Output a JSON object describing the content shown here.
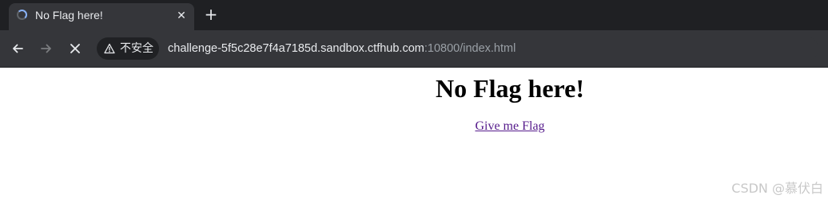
{
  "browser": {
    "tab": {
      "title": "No Flag here!",
      "loading": true
    },
    "toolbar": {
      "security_label": "不安全",
      "url_host": "challenge-5f5c28e7f4a7185d.sandbox.ctfhub.com",
      "url_rest": ":10800/index.html"
    },
    "icons": {
      "back": "arrow-left-icon",
      "forward": "arrow-right-icon",
      "stop": "close-icon",
      "new_tab": "plus-icon",
      "tab_close": "close-icon",
      "security": "warning-triangle-icon"
    },
    "colors": {
      "chrome_dark": "#1f2023",
      "toolbar": "#35363a",
      "text_light": "#e8eaed",
      "text_dim": "#9aa0a6",
      "visited_link": "#551a8b"
    }
  },
  "page": {
    "heading": "No Flag here!",
    "link_text": "Give me Flag"
  },
  "watermark": "CSDN @慕伏白"
}
